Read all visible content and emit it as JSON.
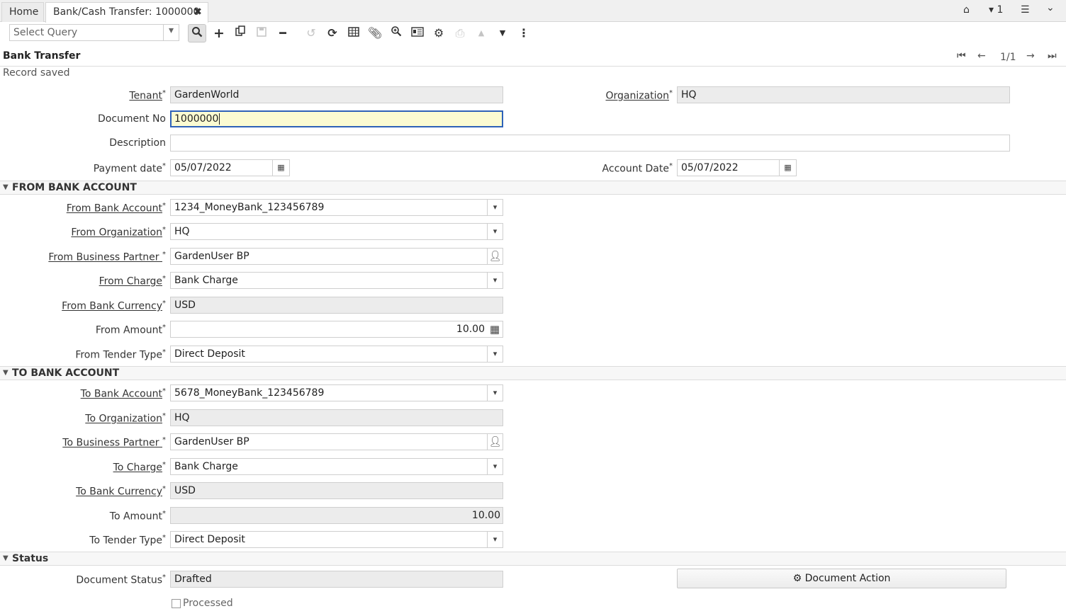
{
  "tabs": {
    "home": "Home",
    "active": "Bank/Cash Transfer: 1000000",
    "close_icon": "✖"
  },
  "topright": {
    "home_icon": "⌂",
    "windows_count": "▾ 1",
    "menu_icon": "☰",
    "collapse_icon": "⌄"
  },
  "toolbar": {
    "query_placeholder": "Select Query"
  },
  "header": {
    "title": "Bank Transfer",
    "record_pos": "1/1"
  },
  "status_message": "Record saved",
  "fields": {
    "tenant": {
      "label": "Tenant",
      "value": "GardenWorld"
    },
    "organization": {
      "label": "Organization",
      "value": "HQ"
    },
    "document_no": {
      "label": "Document No",
      "value": "1000000"
    },
    "description": {
      "label": "Description",
      "value": ""
    },
    "payment_date": {
      "label": "Payment date",
      "value": "05/07/2022"
    },
    "account_date": {
      "label": "Account Date",
      "value": "05/07/2022"
    }
  },
  "from_section": {
    "title": "FROM BANK ACCOUNT",
    "bank_account": {
      "label": "From Bank Account",
      "value": "1234_MoneyBank_123456789"
    },
    "organization": {
      "label": "From Organization",
      "value": "HQ"
    },
    "business_partner": {
      "label": "From Business Partner ",
      "value": "GardenUser BP"
    },
    "charge": {
      "label": "From Charge",
      "value": "Bank Charge"
    },
    "currency": {
      "label": "From Bank Currency",
      "value": "USD"
    },
    "amount": {
      "label": "From Amount",
      "value": "10.00"
    },
    "tender_type": {
      "label": "From Tender Type",
      "value": "Direct Deposit"
    }
  },
  "to_section": {
    "title": "TO BANK ACCOUNT",
    "bank_account": {
      "label": "To Bank Account",
      "value": "5678_MoneyBank_123456789"
    },
    "organization": {
      "label": "To Organization",
      "value": "HQ"
    },
    "business_partner": {
      "label": "To Business Partner ",
      "value": "GardenUser BP"
    },
    "charge": {
      "label": "To Charge",
      "value": "Bank Charge"
    },
    "currency": {
      "label": "To Bank Currency",
      "value": "USD"
    },
    "amount": {
      "label": "To Amount",
      "value": "10.00"
    },
    "tender_type": {
      "label": "To Tender Type",
      "value": "Direct Deposit"
    }
  },
  "status_section": {
    "title": "Status",
    "document_status": {
      "label": "Document Status",
      "value": "Drafted"
    },
    "document_action": "Document Action",
    "processed": "Processed"
  }
}
